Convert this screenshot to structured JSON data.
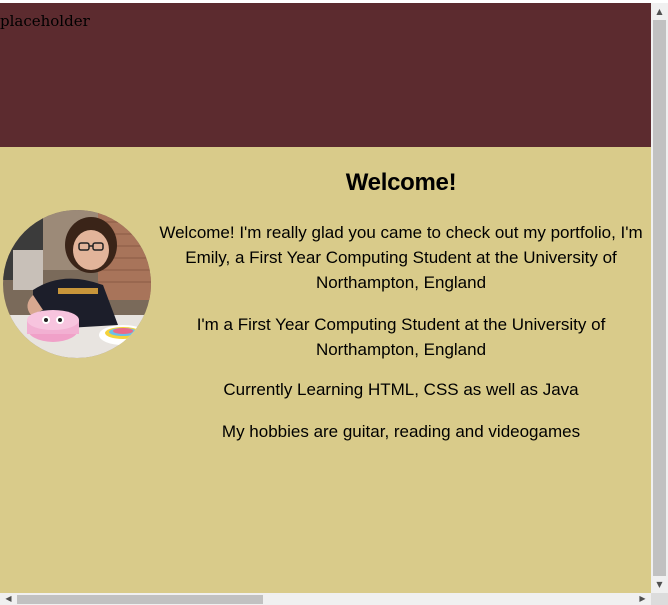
{
  "header": {
    "placeholder_text": "placeholder",
    "background_color": "#5c2b2f"
  },
  "main": {
    "background_color": "#d9cb8a",
    "title": "Welcome!",
    "paragraphs": [
      "Welcome! I'm really glad you came to check out my portfolio, I'm Emily, a First Year Computing Student at the University of Northampton, England",
      "I'm a First Year Computing Student at the University of Northampton, England",
      "Currently Learning HTML, CSS as well as Java",
      "My hobbies are guitar, reading and videogames"
    ],
    "avatar_icon": "profile-photo"
  },
  "scrollbars": {
    "up_arrow": "▲",
    "down_arrow": "▼",
    "left_arrow": "◀",
    "right_arrow": "▶"
  }
}
